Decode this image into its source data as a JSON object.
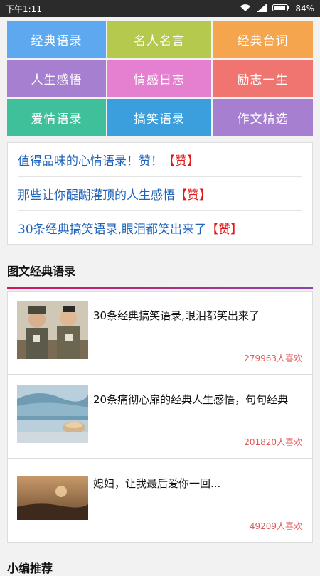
{
  "status": {
    "time": "下午1:11",
    "battery": "84%"
  },
  "categories": [
    {
      "label": "经典语录",
      "color": "#5ea8ef"
    },
    {
      "label": "名人名言",
      "color": "#b5c94f"
    },
    {
      "label": "经典台词",
      "color": "#f5a54d"
    },
    {
      "label": "人生感悟",
      "color": "#a77fd0"
    },
    {
      "label": "情感日志",
      "color": "#e57fd0"
    },
    {
      "label": "励志一生",
      "color": "#f0746f"
    },
    {
      "label": "爱情语录",
      "color": "#3fbf9a"
    },
    {
      "label": "搞笑语录",
      "color": "#3a9fdc"
    },
    {
      "label": "作文精选",
      "color": "#a77fd0"
    }
  ],
  "headlines": [
    {
      "text": "值得品味的心情语录！赞！",
      "tag": "【赞】"
    },
    {
      "text": "那些让你醍醐灌顶的人生感悟",
      "tag": "【赞】"
    },
    {
      "text": "30条经典搞笑语录,眼泪都笑出来了",
      "tag": "【赞】"
    }
  ],
  "section": {
    "title": "图文经典语录"
  },
  "articles": [
    {
      "title": "30条经典搞笑语录,眼泪都笑出来了",
      "likes": "279963人喜欢"
    },
    {
      "title": "20条痛彻心扉的经典人生感悟，句句经典",
      "likes": "201820人喜欢"
    },
    {
      "title": "媳妇，让我最后爱你一回...",
      "likes": "49209人喜欢"
    }
  ],
  "next_section": {
    "title": "小编推荐"
  }
}
